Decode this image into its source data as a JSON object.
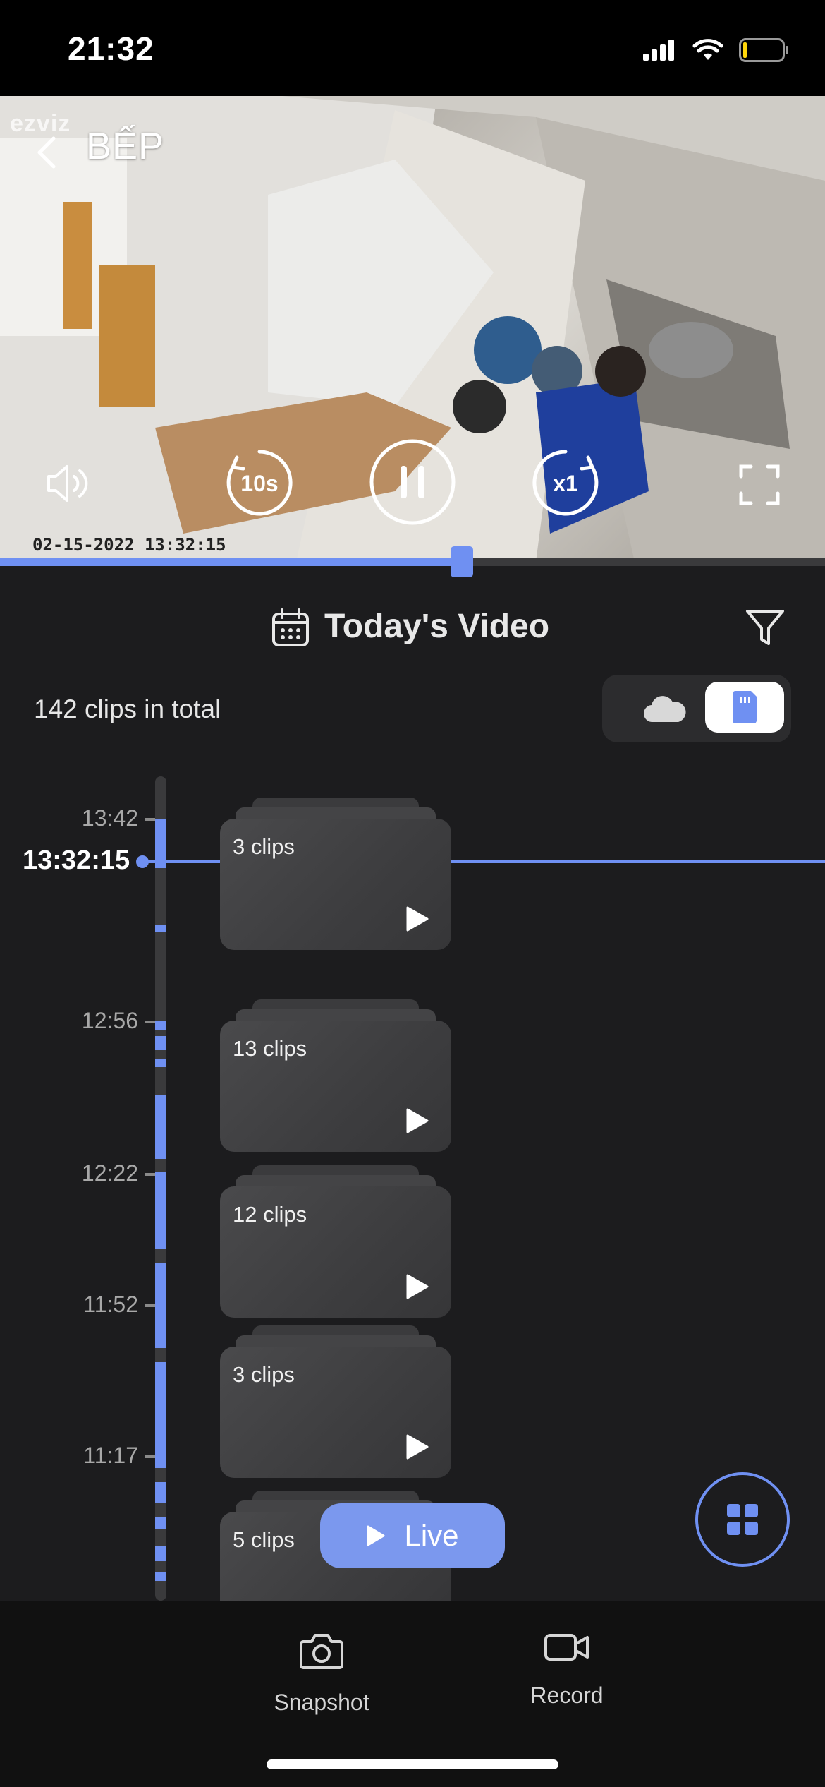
{
  "status_bar": {
    "time": "21:32"
  },
  "camera": {
    "brand": "ezviz",
    "title": "BẾP",
    "timestamp": "02-15-2022 13:32:15"
  },
  "controls": {
    "rewind_label": "10s",
    "speed_label": "x1",
    "progress_fraction": 0.56
  },
  "header": {
    "title": "Today's Video",
    "clips_total": "142 clips in total",
    "storage_selected": "sd-card"
  },
  "timeline": {
    "current_time": "13:32:15",
    "ticks": [
      "13:42",
      "12:56",
      "12:22",
      "11:52",
      "11:17"
    ]
  },
  "clip_groups": [
    {
      "label": "3 clips"
    },
    {
      "label": "13 clips"
    },
    {
      "label": "12 clips"
    },
    {
      "label": "3 clips"
    },
    {
      "label": "5 clips"
    }
  ],
  "live_button": {
    "label": "Live"
  },
  "bottom_bar": {
    "snapshot_label": "Snapshot",
    "record_label": "Record"
  },
  "colors": {
    "accent": "#6f90f2",
    "background": "#1c1c1e"
  }
}
